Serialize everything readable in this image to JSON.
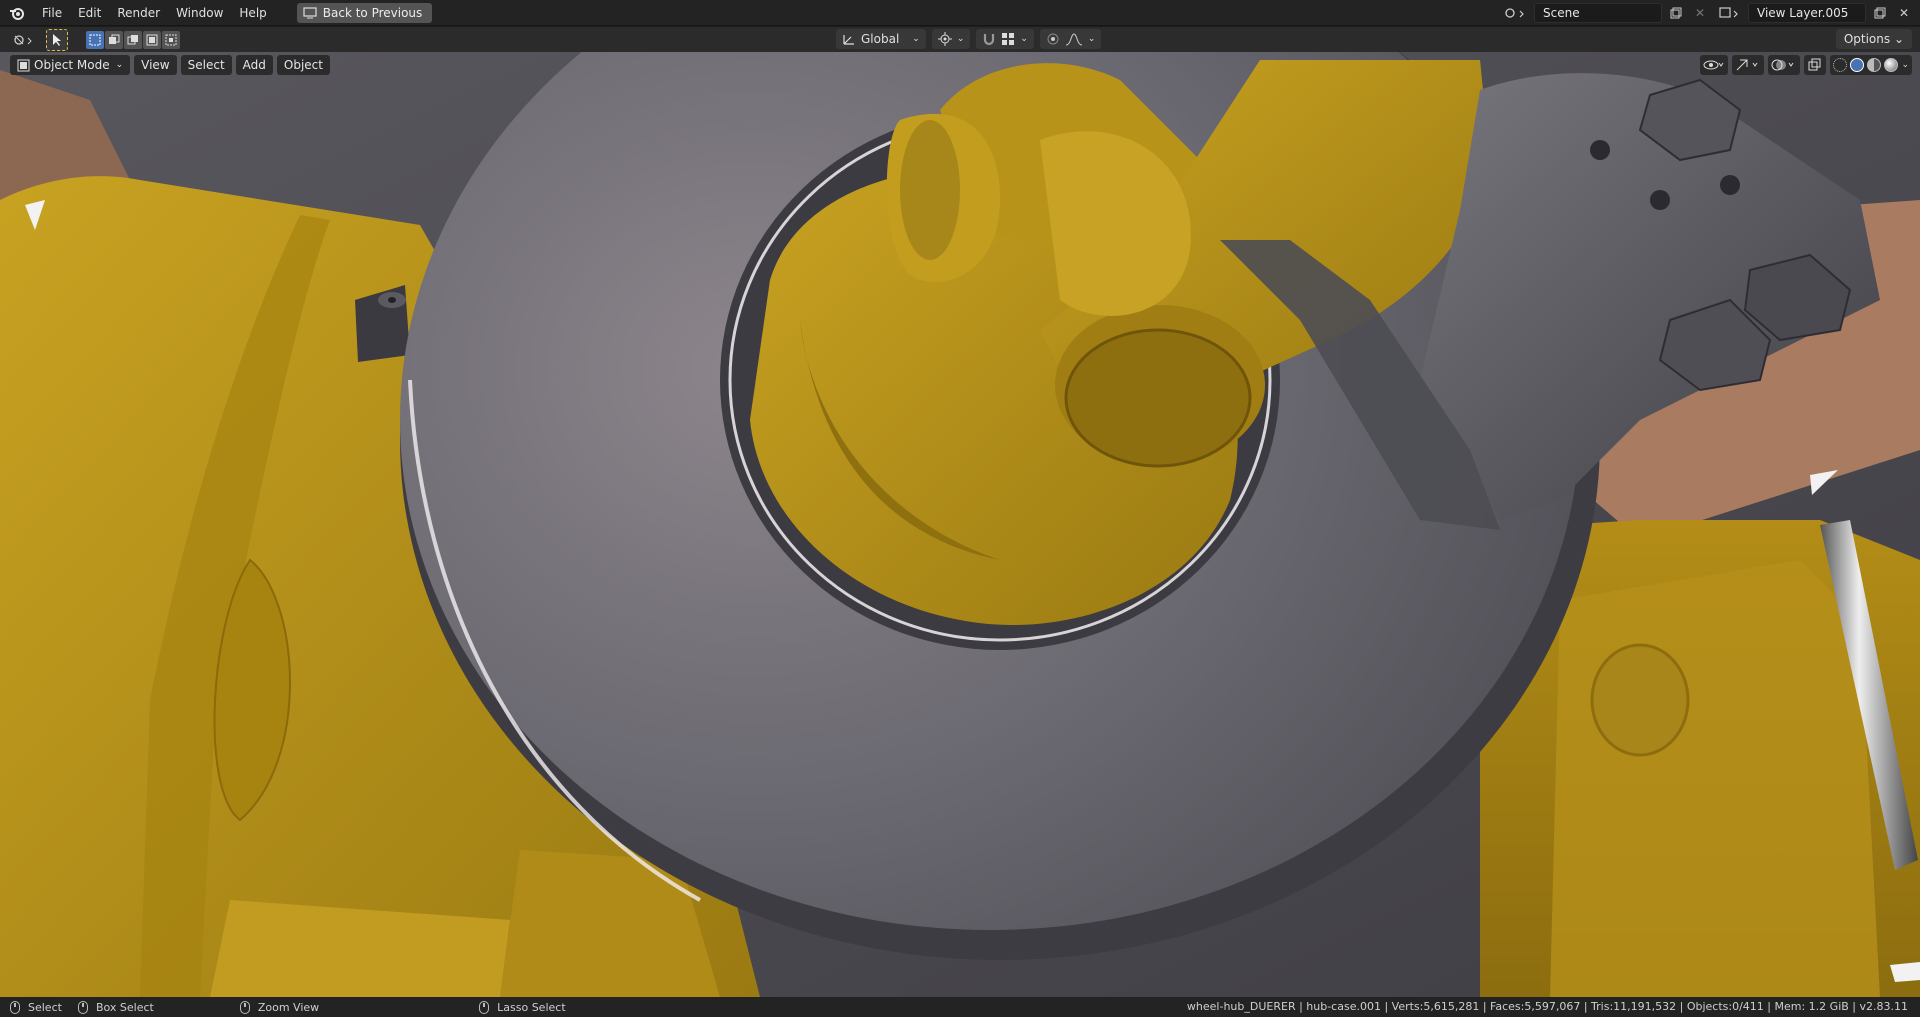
{
  "menubar": {
    "items": [
      "File",
      "Edit",
      "Render",
      "Window",
      "Help"
    ],
    "back_label": "Back to Previous",
    "scene_name": "Scene",
    "view_layer": "View Layer.005"
  },
  "header": {
    "transform_orientation": "Global",
    "options_label": "Options"
  },
  "viewport": {
    "mode": "Object Mode",
    "menus": [
      "View",
      "Select",
      "Add",
      "Object"
    ]
  },
  "statusbar": {
    "select": "Select",
    "box_select": "Box Select",
    "zoom_view": "Zoom View",
    "lasso_select": "Lasso Select",
    "stats": "wheel-hub_DUERER | hub-case.001 | Verts:5,615,281 | Faces:5,597,067 | Tris:11,191,532 | Objects:0/411 | Mem: 1.2 GiB | v2.83.11"
  },
  "colors": {
    "yellow": "#b8931a",
    "disc_gray": "#6f6d74",
    "background": "#4a4a4e",
    "tan": "#a97b60"
  }
}
